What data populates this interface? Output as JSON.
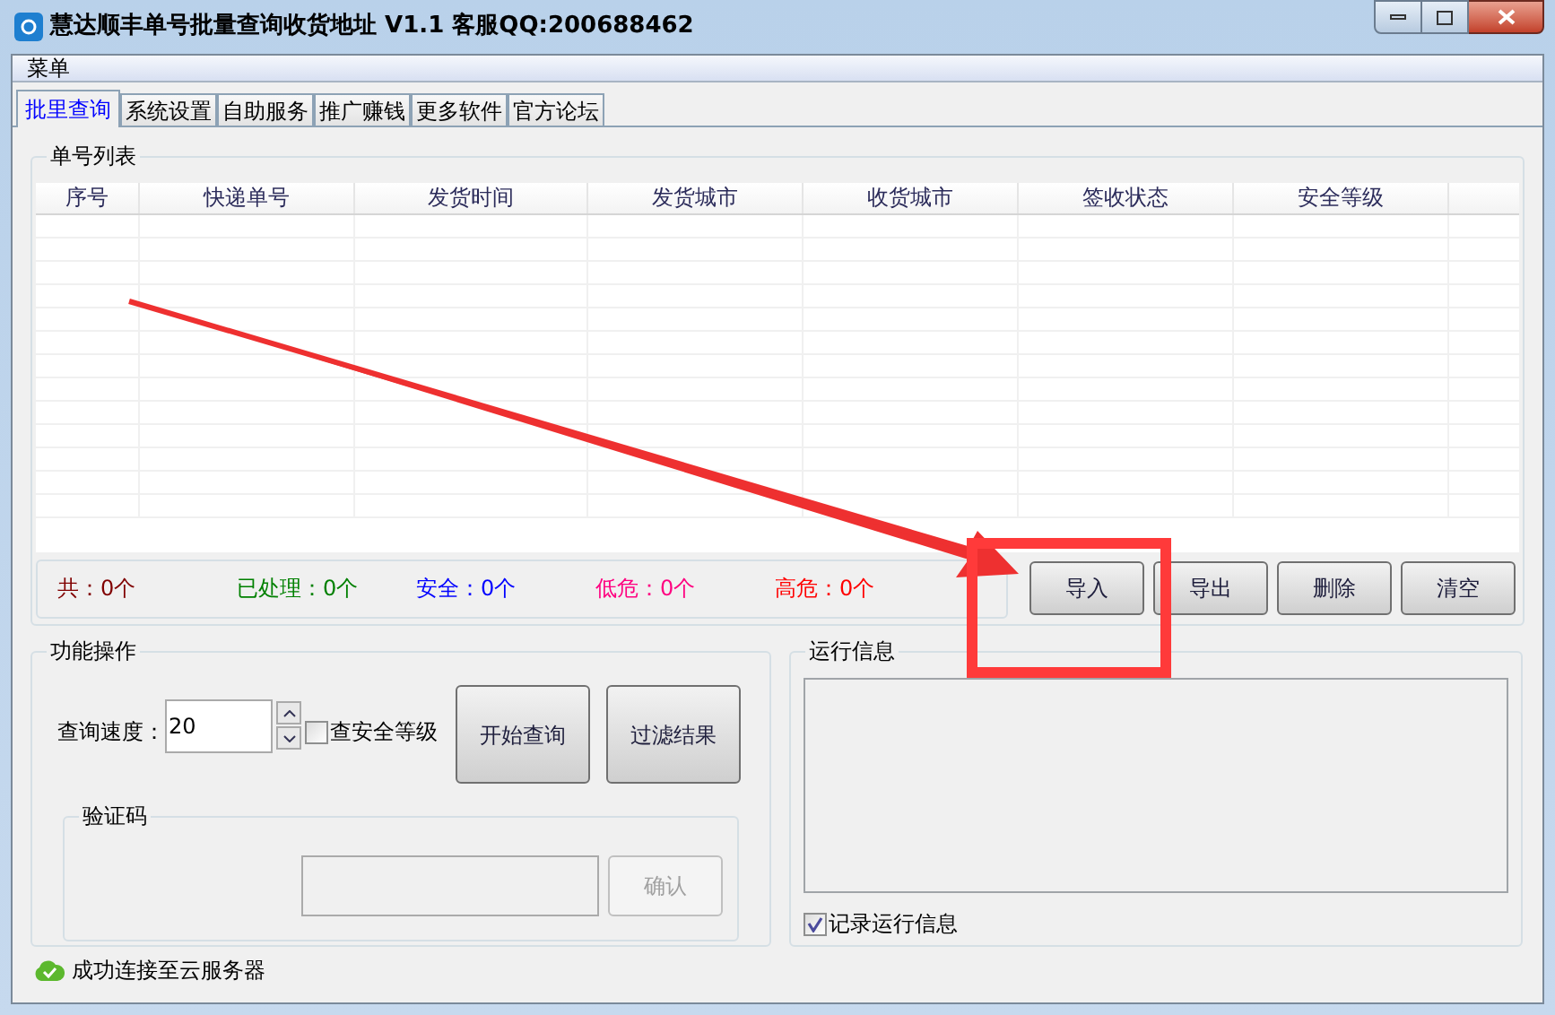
{
  "window": {
    "title": "慧达顺丰单号批量查询收货地址 V1.1 客服QQ:200688462"
  },
  "menu": [
    "菜单"
  ],
  "tabs": [
    {
      "label": "批里查询",
      "selected": true
    },
    {
      "label": "系统设置",
      "selected": false
    },
    {
      "label": "自助服务",
      "selected": false
    },
    {
      "label": "推广赚钱",
      "selected": false
    },
    {
      "label": "更多软件",
      "selected": false
    },
    {
      "label": "官方论坛",
      "selected": false
    }
  ],
  "order_list": {
    "title": "单号列表",
    "columns": [
      "序号",
      "快递单号",
      "发货时间",
      "发货城市",
      "收货城市",
      "签收状态",
      "安全等级"
    ]
  },
  "stats": [
    {
      "label": "共：",
      "value": "0个",
      "color": "#800000"
    },
    {
      "label": "已处理：",
      "value": "0个",
      "color": "#008000"
    },
    {
      "label": "安全：",
      "value": "0个",
      "color": "#0000ff"
    },
    {
      "label": "低危：",
      "value": "0个",
      "color": "#ff0080"
    },
    {
      "label": "高危：",
      "value": "0个",
      "color": "#ff0000"
    }
  ],
  "list_buttons": [
    "导入",
    "导出",
    "删除",
    "清空"
  ],
  "operations": {
    "title": "功能操作",
    "speed_label": "查询速度：",
    "speed_value": "20",
    "check_level": {
      "label": "查安全等级",
      "checked": false
    },
    "buttons": [
      "开始查询",
      "过滤结果"
    ],
    "captcha": {
      "title": "验证码",
      "confirm": {
        "label": "确认",
        "disabled": true
      }
    }
  },
  "run_info": {
    "title": "运行信息",
    "log": {
      "label": "记录运行信息",
      "checked": true
    }
  },
  "status_bar": {
    "text": "成功连接至云服务器"
  }
}
